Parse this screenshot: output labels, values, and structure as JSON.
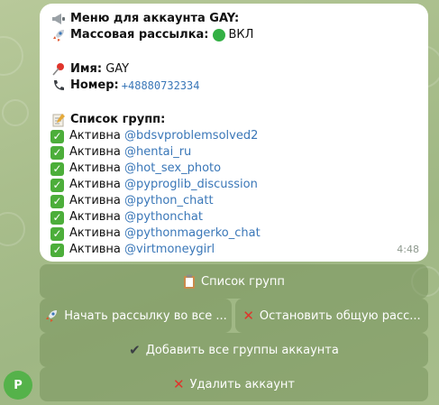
{
  "message": {
    "header": {
      "icon": "megaphone-icon",
      "text": "Меню для аккаунта GAY:"
    },
    "mass_mailing": {
      "icon": "rocket-icon",
      "label": "Массовая рассылка:",
      "status_icon": "green-circle-icon",
      "status": "ВКЛ"
    },
    "name": {
      "icon": "pushpin-icon",
      "label": "Имя:",
      "value": "GAY"
    },
    "phone": {
      "icon": "phone-icon",
      "label": "Номер:",
      "value": "+48880732334"
    },
    "groups_header": {
      "icon": "memo-icon",
      "label": "Список групп:"
    },
    "groups": [
      {
        "status": "Активна",
        "handle": "@bdsvproblemsolved2"
      },
      {
        "status": "Активна",
        "handle": "@hentai_ru"
      },
      {
        "status": "Активна",
        "handle": "@hot_sex_photo"
      },
      {
        "status": "Активна",
        "handle": "@pyproglib_discussion"
      },
      {
        "status": "Активна",
        "handle": "@python_chatt"
      },
      {
        "status": "Активна",
        "handle": "@pythonchat"
      },
      {
        "status": "Активна",
        "handle": "@pythonmagerko_chat"
      },
      {
        "status": "Активна",
        "handle": "@virtmoneygirl"
      }
    ],
    "time": "4:48"
  },
  "keyboard": {
    "group_list": {
      "icon": "clipboard-icon",
      "label": "Список групп"
    },
    "start_mailing": {
      "icon": "rocket-icon",
      "label": "Начать рассылку во все ..."
    },
    "stop_mailing": {
      "icon": "red-x-icon",
      "label": "Остановить общую расс..."
    },
    "add_all_groups": {
      "icon": "check-mark-icon",
      "label": "Добавить все группы аккаунта"
    },
    "delete_account": {
      "icon": "red-x-icon",
      "label": "Удалить аккаунт"
    }
  },
  "avatar": {
    "letter": "P"
  },
  "colors": {
    "link": "#3a77b8",
    "check": "#4cae3a",
    "button_bg": "#7a9560",
    "danger": "#e0342b"
  }
}
